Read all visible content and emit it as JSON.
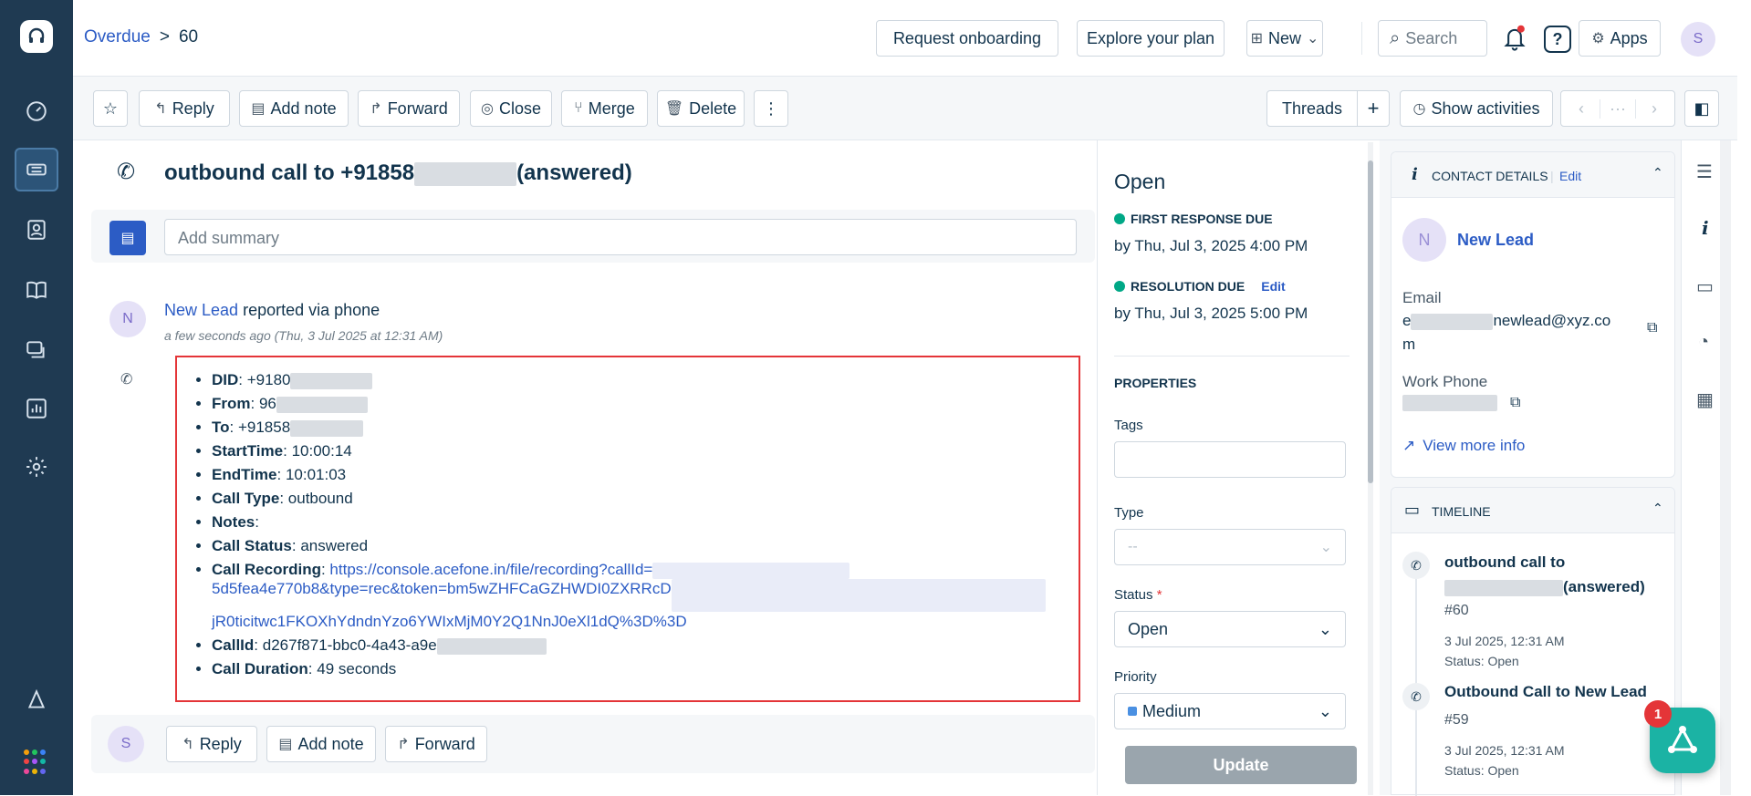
{
  "breadcrumb": {
    "parent": "Overdue",
    "separator": ">",
    "current": "60"
  },
  "topbar": {
    "request_onboarding": "Request onboarding",
    "explore_plan": "Explore your plan",
    "new_label": "New",
    "search_placeholder": "Search",
    "apps_label": "Apps",
    "avatar": "S"
  },
  "toolbar": {
    "reply": "Reply",
    "add_note": "Add note",
    "forward": "Forward",
    "close": "Close",
    "merge": "Merge",
    "delete": "Delete",
    "more": "⋮",
    "threads": "Threads",
    "plus": "+",
    "show_activities": "Show activities",
    "prev": "‹",
    "ellipsis": "···",
    "next": "›"
  },
  "ticket": {
    "title_prefix": "outbound call to +91858",
    "title_suffix": "(answered)",
    "summary_placeholder": "Add summary",
    "requester_avatar": "N",
    "requester_name": "New Lead",
    "reported_via": "reported via phone",
    "timestamp": "a few seconds ago (Thu, 3 Jul 2025 at 12:31 AM)",
    "details": [
      {
        "key": "DID",
        "value": "+9180"
      },
      {
        "key": "From",
        "value": "96"
      },
      {
        "key": "To",
        "value": "+91858"
      },
      {
        "key": "StartTime",
        "value": "10:00:14"
      },
      {
        "key": "EndTime",
        "value": "10:01:03"
      },
      {
        "key": "Call Type",
        "value": "outbound"
      },
      {
        "key": "Notes",
        "value": ""
      },
      {
        "key": "Call Status",
        "value": "answered"
      },
      {
        "key": "Call Recording",
        "value": ""
      },
      {
        "key": "CallId",
        "value": "d267f871-bbc0-4a43-a9e"
      },
      {
        "key": "Call Duration",
        "value": "49 seconds"
      }
    ],
    "recording_url_1": "https://console.acefone.in/file/recording?callId=",
    "recording_url_2": "5d5fea4e770b8&type=rec&token=bm5wZHFCaGZHWDI0ZXRRcD",
    "recording_url_3": "jR0ticitwc1FKOXhYdndnYzo6YWIxMjM0Y2Q1NnJ0eXl1dQ%3D%3D",
    "reply_avatar": "S",
    "reply": "Reply",
    "add_note": "Add note",
    "forward": "Forward"
  },
  "properties": {
    "status_title": "Open",
    "first_response_label": "FIRST RESPONSE DUE",
    "first_response_date": "by Thu, Jul 3, 2025 4:00 PM",
    "resolution_label": "RESOLUTION DUE",
    "resolution_edit": "Edit",
    "resolution_date": "by Thu, Jul 3, 2025 5:00 PM",
    "section": "PROPERTIES",
    "tags_label": "Tags",
    "type_label": "Type",
    "type_value": "--",
    "status_label": "Status",
    "required": "*",
    "status_value": "Open",
    "priority_label": "Priority",
    "priority_value": "Medium",
    "priority_color": "#4a90e2",
    "update": "Update"
  },
  "contact": {
    "header": "CONTACT DETAILS",
    "edit": "Edit",
    "avatar": "N",
    "name": "New Lead",
    "email_label": "Email",
    "email_prefix": "e",
    "email_value": "newlead@xyz.co",
    "email_tail": "m",
    "phone_label": "Work Phone",
    "view_more": "View more info"
  },
  "timeline": {
    "header": "TIMELINE",
    "items": [
      {
        "title_1": "outbound call to",
        "title_2": "(answered)",
        "number": "#60",
        "date": "3 Jul 2025, 12:31 AM",
        "status": "Status: Open"
      },
      {
        "title_1": "Outbound Call to New Lead",
        "number": "#59",
        "date": "3 Jul 2025, 12:31 AM",
        "status": "Status: Open"
      }
    ]
  },
  "fab": {
    "badge": "1"
  },
  "colors": {
    "sidebar": "#1f3a52",
    "accent": "#2c5cc5",
    "danger": "#e43538",
    "success": "#00a886",
    "fab": "#1bb3a4"
  }
}
